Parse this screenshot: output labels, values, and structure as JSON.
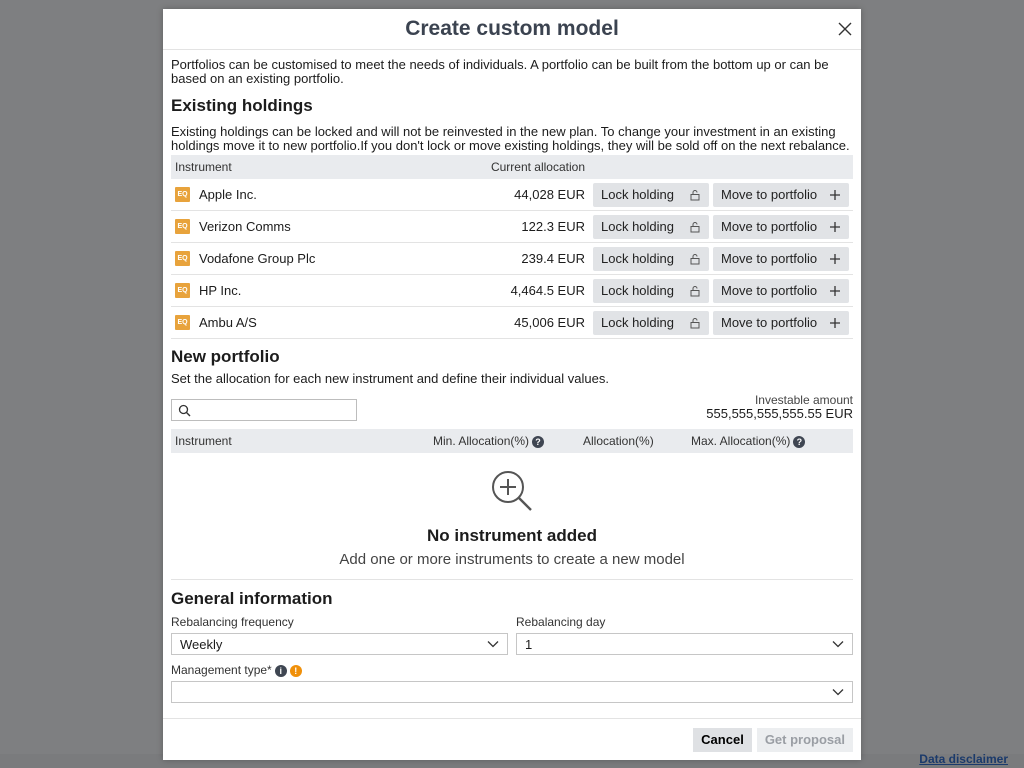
{
  "modal": {
    "title": "Create custom model",
    "intro": "Portfolios can be customised to meet the needs of individuals. A portfolio can be built from the bottom up or can be based on an existing portfolio."
  },
  "existing": {
    "heading": "Existing holdings",
    "description": "Existing holdings can be locked and will not be reinvested in the new plan. To change your investment in an existing holdings move it to new portfolio.If you don't lock or move existing holdings, they will be sold off on the next rebalance.",
    "col_instrument": "Instrument",
    "col_allocation": "Current allocation",
    "lock_label": "Lock holding",
    "move_label": "Move to portfolio",
    "badge": "EQ",
    "rows": [
      {
        "name": "Apple Inc.",
        "amount": "44,028 EUR"
      },
      {
        "name": "Verizon Comms",
        "amount": "122.3 EUR"
      },
      {
        "name": "Vodafone Group Plc",
        "amount": "239.4 EUR"
      },
      {
        "name": "HP Inc.",
        "amount": "4,464.5 EUR"
      },
      {
        "name": "Ambu A/S",
        "amount": "45,006 EUR"
      }
    ]
  },
  "new_portfolio": {
    "heading": "New portfolio",
    "description": "Set the allocation for each new instrument and define their individual values.",
    "search_placeholder": "",
    "investable_label": "Investable amount",
    "investable_value": "555,555,555,555.55 EUR",
    "col_instrument": "Instrument",
    "col_min": "Min. Allocation(%)",
    "col_alloc": "Allocation(%)",
    "col_max": "Max. Allocation(%)",
    "empty_title": "No instrument added",
    "empty_subtitle": "Add one or more instruments to create a new model"
  },
  "general": {
    "heading": "General information",
    "freq_label": "Rebalancing frequency",
    "freq_value": "Weekly",
    "day_label": "Rebalancing day",
    "day_value": "1",
    "mgmt_label": "Management type*",
    "mgmt_value": ""
  },
  "footer": {
    "cancel": "Cancel",
    "proposal": "Get proposal"
  },
  "page": {
    "disclaimer": "Data disclaimer"
  },
  "colors": {
    "accent_badge": "#e8a33c",
    "warning": "#f0900a",
    "header_bg": "#e9ebee"
  }
}
